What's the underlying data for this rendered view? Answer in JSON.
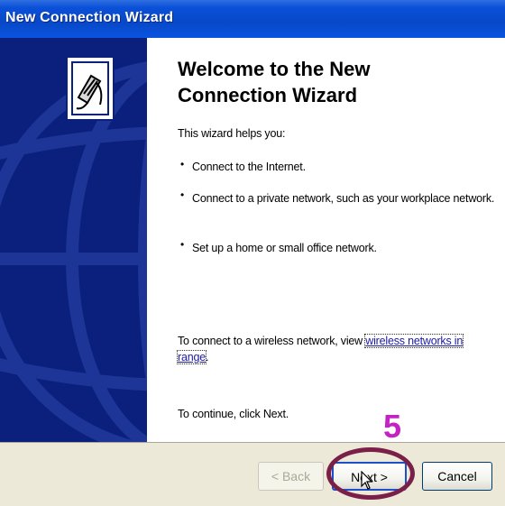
{
  "window": {
    "title": "New Connection Wizard"
  },
  "main": {
    "heading": "Welcome to the New Connection Wizard",
    "intro": "This wizard helps you:",
    "bullets": [
      "Connect to the Internet.",
      "Connect to a private network, such as your workplace network.",
      "Set up a home or small office network."
    ],
    "wireless_prefix": "To connect to a wireless network, view ",
    "wireless_link_line1": "wireless networks in",
    "wireless_link_line2": "range",
    "wireless_suffix": ".",
    "continue_text": "To continue, click Next."
  },
  "buttons": {
    "back": "< Back",
    "next": "Next >",
    "cancel": "Cancel"
  },
  "annotation": {
    "step": "5"
  },
  "colors": {
    "titlebar": "#0a50d8",
    "sidepanel": "#0b1f7c",
    "ring": "#7a1f48",
    "step": "#c323c3"
  }
}
